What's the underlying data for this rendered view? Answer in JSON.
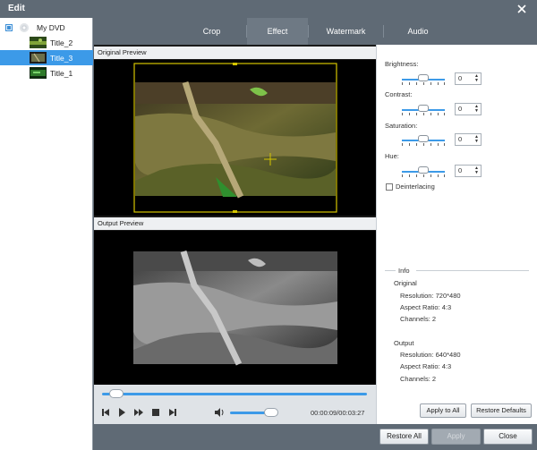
{
  "window": {
    "title": "Edit"
  },
  "sidebar": {
    "root_label": "My DVD",
    "items": [
      {
        "label": "Title_2",
        "selected": false
      },
      {
        "label": "Title_3",
        "selected": true
      },
      {
        "label": "Title_1",
        "selected": false
      }
    ]
  },
  "tabs": [
    {
      "label": "Crop",
      "active": false
    },
    {
      "label": "Effect",
      "active": true
    },
    {
      "label": "Watermark",
      "active": false
    },
    {
      "label": "Audio",
      "active": false
    }
  ],
  "preview": {
    "original_label": "Original Preview",
    "output_label": "Output Preview"
  },
  "player": {
    "time": "00:00:09/00:03:27"
  },
  "effects": {
    "brightness_label": "Brightness:",
    "brightness_value": "0",
    "contrast_label": "Contrast:",
    "contrast_value": "0",
    "saturation_label": "Saturation:",
    "saturation_value": "0",
    "hue_label": "Hue:",
    "hue_value": "0",
    "deinterlacing_label": "Deinterlacing"
  },
  "info": {
    "title": "Info",
    "original_heading": "Original",
    "original_resolution": "Resolution: 720*480",
    "original_aspect": "Aspect Ratio: 4:3",
    "original_channels": "Channels: 2",
    "output_heading": "Output",
    "output_resolution": "Resolution: 640*480",
    "output_aspect": "Aspect Ratio: 4:3",
    "output_channels": "Channels: 2"
  },
  "buttons": {
    "apply_to_all": "Apply to All",
    "restore_defaults": "Restore Defaults",
    "restore_all": "Restore All",
    "apply": "Apply",
    "close": "Close"
  },
  "colors": {
    "accent": "#3c9ae8",
    "chrome": "#5f6a75",
    "crop_frame": "#d4c400"
  }
}
